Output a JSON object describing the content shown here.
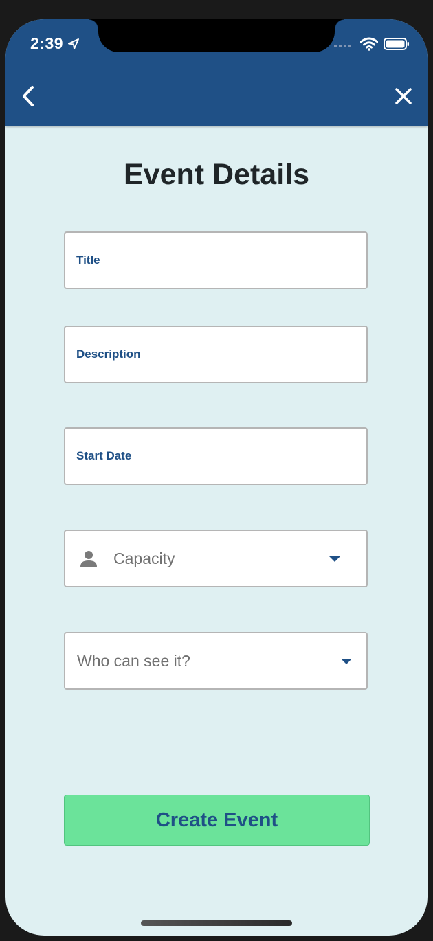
{
  "status_bar": {
    "time": "2:39"
  },
  "header": {
    "back_icon": "chevron-left-icon",
    "close_icon": "close-icon"
  },
  "page": {
    "title": "Event Details"
  },
  "form": {
    "title_label": "Title",
    "description_label": "Description",
    "start_date_label": "Start Date",
    "capacity_placeholder": "Capacity",
    "visibility_placeholder": "Who can see it?"
  },
  "actions": {
    "create_label": "Create Event"
  },
  "colors": {
    "header": "#1f5086",
    "background": "#dff0f2",
    "button": "#6be39a",
    "accent_text": "#1f5086"
  }
}
